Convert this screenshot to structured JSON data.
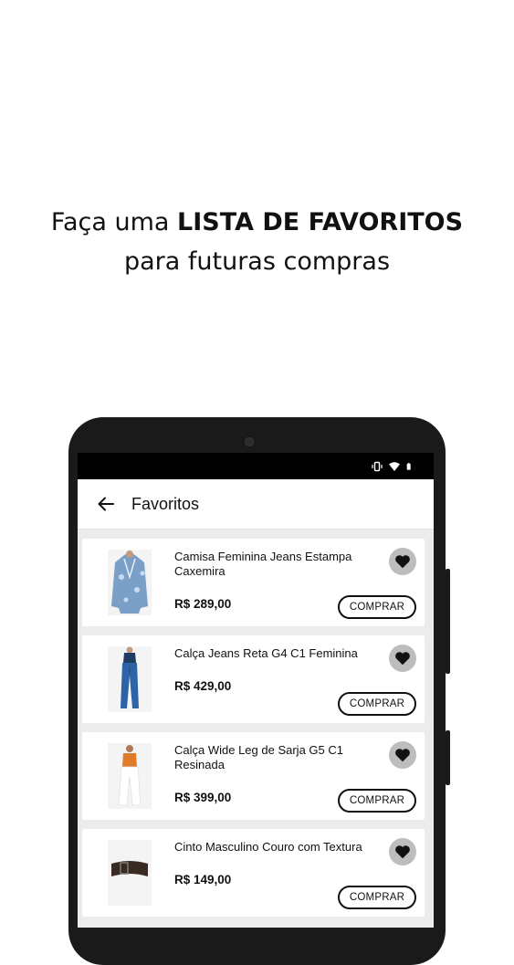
{
  "headline": {
    "line1_prefix": "Faça uma ",
    "line1_bold": "LISTA DE FAVORITOS",
    "line2": "para futuras compras"
  },
  "appbar": {
    "title": "Favoritos"
  },
  "items": [
    {
      "name": "Camisa Feminina Jeans Estampa Caxemira",
      "price": "R$ 289,00",
      "buy": "COMPRAR"
    },
    {
      "name": "Calça Jeans Reta G4 C1 Feminina",
      "price": "R$ 429,00",
      "buy": "COMPRAR"
    },
    {
      "name": "Calça Wide Leg de Sarja G5 C1 Resinada",
      "price": "R$ 399,00",
      "buy": "COMPRAR"
    },
    {
      "name": "Cinto Masculino Couro com Textura",
      "price": "R$ 149,00",
      "buy": "COMPRAR"
    }
  ],
  "colors": {
    "accent": "#111111",
    "fav_bg": "#bdbdbd",
    "list_bg": "#ececec"
  },
  "icons": [
    "back-arrow-icon",
    "vibrate-icon",
    "wifi-icon",
    "battery-icon",
    "heart-icon"
  ]
}
